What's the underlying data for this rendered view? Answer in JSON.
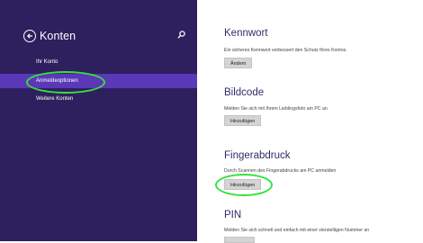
{
  "nav": {
    "title": "Konten",
    "back_icon": "back-arrow-circle-icon",
    "search_icon": "search-icon",
    "items": [
      {
        "label": "Ihr Konto",
        "selected": false
      },
      {
        "label": "Anmeldeoptionen",
        "selected": true
      },
      {
        "label": "Weitere Konten",
        "selected": false
      }
    ]
  },
  "sections": [
    {
      "title": "Kennwort",
      "description": "Ein sicheres Kennwort verbessert den Schutz Ihres Kontos.",
      "button": "Ändern"
    },
    {
      "title": "Bildcode",
      "description": "Melden Sie sich mit Ihrem Lieblingsfoto am PC an",
      "button": "Hinzufügen"
    },
    {
      "title": "Fingerabdruck",
      "description": "Durch Scannen des Fingerabdrucks am PC anmelden",
      "button": "Hinzufügen"
    },
    {
      "title": "PIN",
      "description": "Melden Sie sich schnell und einfach mit einer vierstelligen Nummer an",
      "button": ""
    }
  ],
  "colors": {
    "nav_background": "#2e1f5e",
    "nav_selected": "#5a38b8",
    "section_title": "#2e2e6a",
    "button_background": "#d4d4d4",
    "highlight": "#35e23c"
  }
}
